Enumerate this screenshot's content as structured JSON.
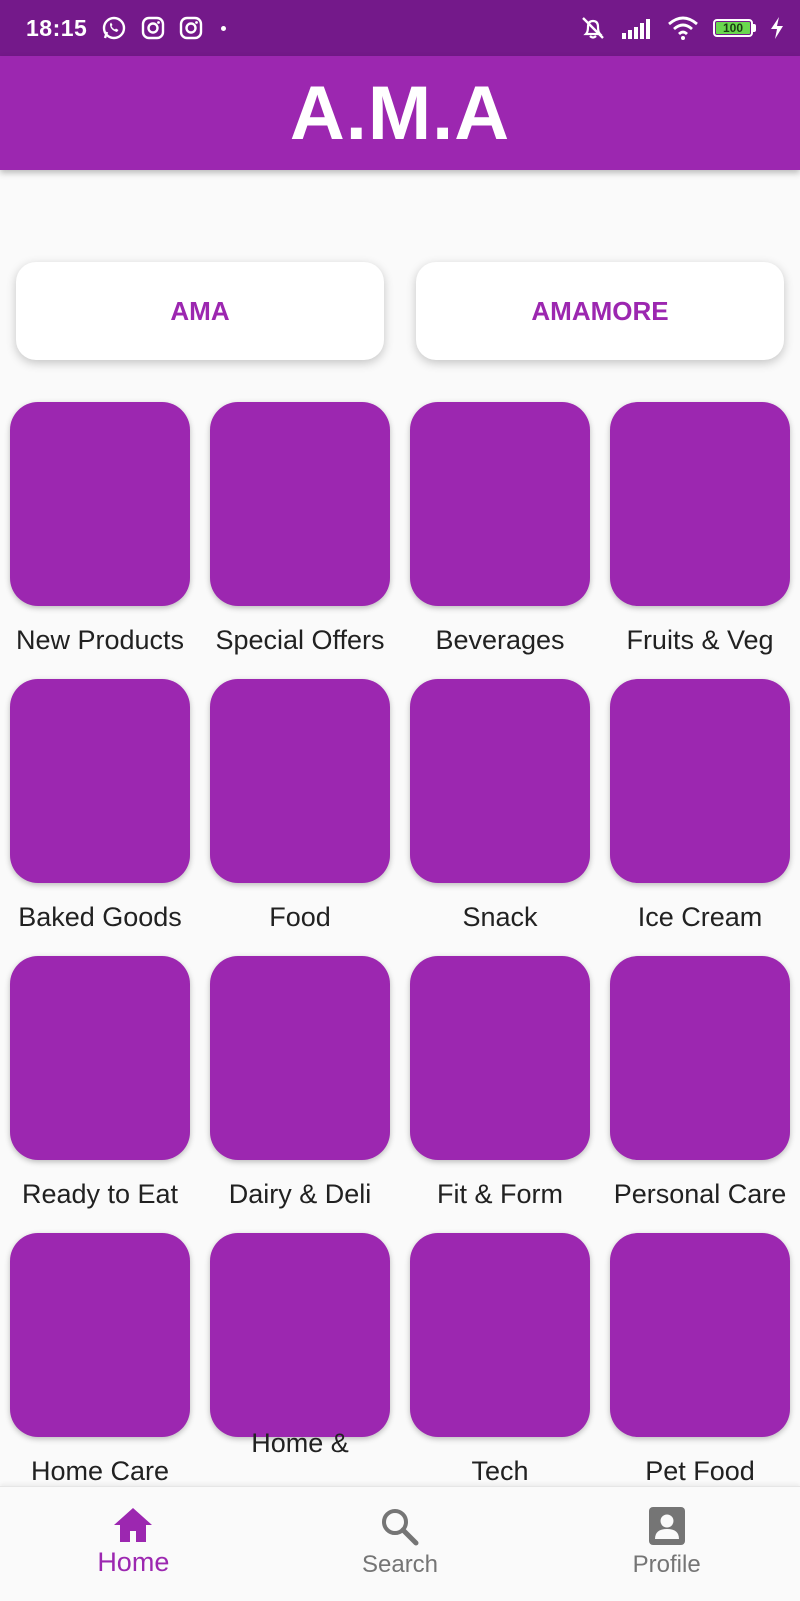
{
  "status_bar": {
    "time": "18:15",
    "battery_level": "100",
    "icons": [
      "whatsapp-icon",
      "instagram-icon",
      "instagram-icon",
      "notification-dot",
      "alarm-off-icon",
      "signal-icon",
      "wifi-icon",
      "battery-icon",
      "charging-icon"
    ]
  },
  "app_bar": {
    "title": "A.M.A"
  },
  "tabs": [
    "AMA",
    "AMAMORE"
  ],
  "categories": [
    "New Products",
    "Special Offers",
    "Beverages",
    "Fruits & Veg",
    "Baked Goods",
    "Food",
    "Snack",
    "Ice Cream",
    "Ready to Eat",
    "Dairy & Deli",
    "Fit & Form",
    "Personal Care",
    "Home Care",
    "Home &",
    "Tech",
    "Pet Food"
  ],
  "bottom_nav": {
    "items": [
      {
        "label": "Home",
        "icon": "home-icon",
        "active": true
      },
      {
        "label": "Search",
        "icon": "search-icon",
        "active": false
      },
      {
        "label": "Profile",
        "icon": "profile-icon",
        "active": false
      }
    ]
  },
  "colors": {
    "primary": "#9c27b0",
    "status_bar": "#74198a",
    "background": "#fafafa",
    "text": "#212121",
    "inactive": "#757575"
  }
}
